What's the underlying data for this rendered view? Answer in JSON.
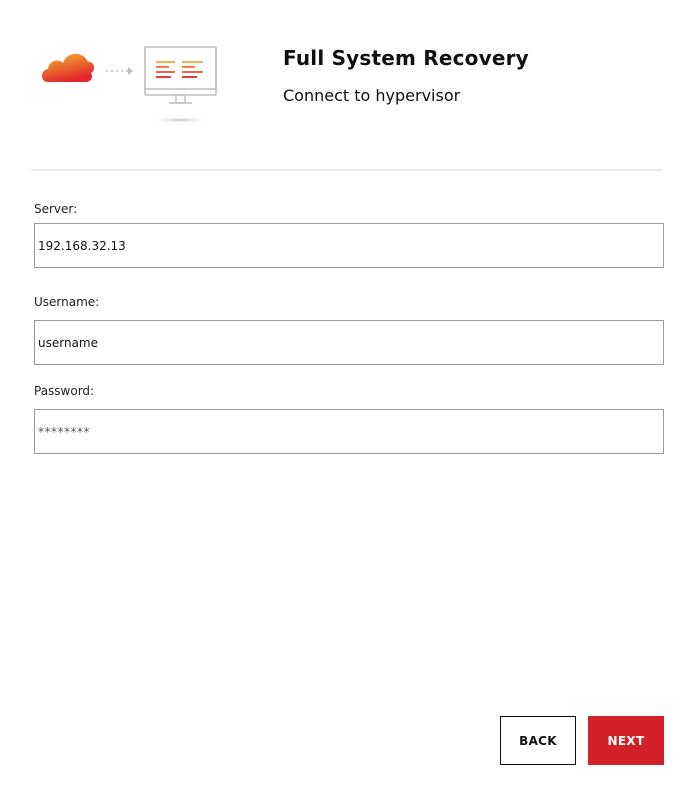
{
  "header": {
    "title": "Full System Recovery",
    "subtitle": "Connect to hypervisor",
    "illustration": {
      "icons": [
        "cloud-icon",
        "dotted-arrow-icon",
        "monitor-icon"
      ],
      "cloud_gradient": [
        "#f6b82c",
        "#e2262c"
      ]
    }
  },
  "form": {
    "server": {
      "label": "Server:",
      "value": "192.168.32.13"
    },
    "username": {
      "label": "Username:",
      "value": "username"
    },
    "password": {
      "label": "Password:",
      "value": "********"
    }
  },
  "buttons": {
    "back_label": "BACK",
    "next_label": "NEXT"
  },
  "colors": {
    "accent": "#d32029",
    "input_border": "#9a9a9a",
    "divider": "#ececec"
  }
}
